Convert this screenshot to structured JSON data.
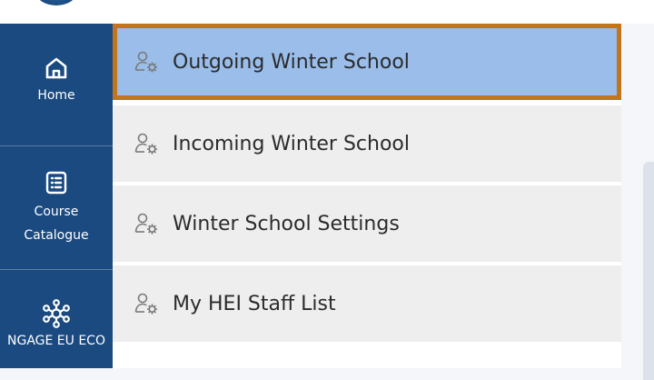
{
  "sidebar": {
    "items": [
      {
        "label": "Home",
        "icon": "home-icon"
      },
      {
        "label": "Course\nCatalogue",
        "icon": "catalogue-icon"
      },
      {
        "label": "NGAGE EU ECO",
        "icon": "network-icon"
      }
    ]
  },
  "menu": {
    "items": [
      {
        "label": "Outgoing Winter School",
        "icon": "user-gear-icon",
        "active": true
      },
      {
        "label": "Incoming Winter School",
        "icon": "user-gear-icon",
        "active": false
      },
      {
        "label": "Winter School Settings",
        "icon": "user-gear-icon",
        "active": false
      },
      {
        "label": "My HEI Staff List",
        "icon": "user-gear-icon",
        "active": false
      }
    ]
  },
  "colors": {
    "sidebar_bg": "#1b4a80",
    "active_bg": "#9abde9",
    "active_border": "#c1761b",
    "item_bg": "#eeeeee"
  }
}
